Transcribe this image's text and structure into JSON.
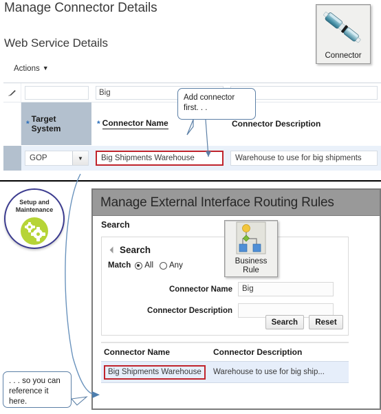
{
  "top_panel": {
    "page_title": "Manage Connector Details",
    "section_title": "Web Service Details",
    "actions_label": "Actions",
    "connector_tile_label": "Connector",
    "table": {
      "qbe": {
        "target_system_filter": "",
        "connector_name_filter": "Big",
        "connector_description_filter": ""
      },
      "columns": [
        {
          "label": "Target System",
          "required": true
        },
        {
          "label": "Connector Name",
          "required": true
        },
        {
          "label": "Connector Description",
          "required": false
        }
      ],
      "rows": [
        {
          "target_system": "GOP",
          "connector_name": "Big Shipments Warehouse",
          "connector_description": "Warehouse to use for big shipments"
        }
      ]
    },
    "callout": "Add connector first. . ."
  },
  "bottom_panel": {
    "setup_badge": {
      "line1": "Setup and",
      "line2": "Maintenance"
    },
    "window_title": "Manage External Interface Routing Rules",
    "subheading": "Search",
    "business_rule_tile": {
      "line1": "Business",
      "line2": "Rule"
    },
    "search_panel": {
      "header": "Search",
      "match_label": "Match",
      "match_options": [
        {
          "label": "All",
          "selected": true
        },
        {
          "label": "Any",
          "selected": false
        }
      ],
      "fields": [
        {
          "label": "Connector Name",
          "value": "Big",
          "placeholder": ""
        },
        {
          "label": "Connector Description",
          "value": "",
          "placeholder": ""
        }
      ],
      "buttons": [
        {
          "label": "Search"
        },
        {
          "label": "Reset"
        }
      ]
    },
    "results": {
      "columns": [
        "Connector Name",
        "Connector Description"
      ],
      "rows": [
        {
          "connector_name": "Big Shipments Warehouse",
          "connector_description": "Warehouse to use for big ship..."
        }
      ]
    },
    "callout": ". . . so you can reference  it here."
  },
  "colors": {
    "highlight_red": "#c0232b",
    "callout_blue": "#5b7fa6",
    "header_shade": "#b3c0ce",
    "row_select": "#eaf1fa",
    "badge_ring": "#3b3b8f",
    "badge_disc": "#b6d437",
    "titlebar": "#999999",
    "required_star": "#2a6ebb"
  }
}
